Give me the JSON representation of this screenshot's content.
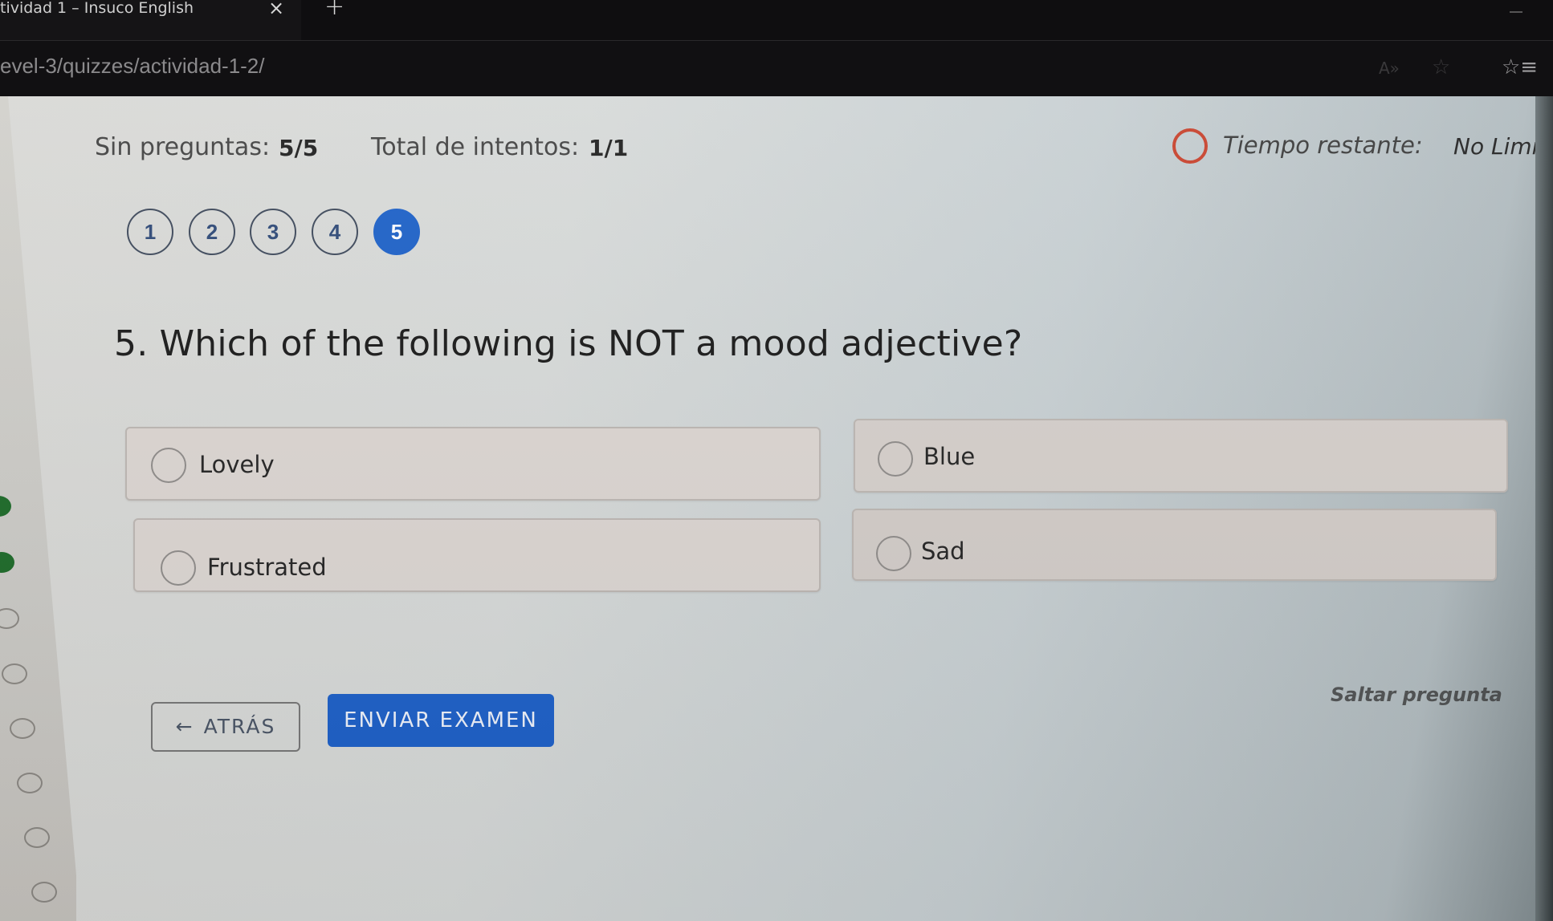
{
  "browser": {
    "tab_title": "tividad 1 – Insuco English",
    "tab_close_icon": "×",
    "new_tab_icon": "+",
    "url": "evel-3/quizzes/actividad-1-2/",
    "icons": {
      "read_aloud": "A»",
      "favorite": "☆",
      "favorites_list": "☆≡"
    }
  },
  "quiz": {
    "questions_label": "Sin preguntas:",
    "questions_value": "5/5",
    "attempts_label": "Total de intentos:",
    "attempts_value": "1/1",
    "timer_label": "Tiempo restante:",
    "timer_value": "No Limit",
    "timer_color": "#c8442f",
    "accent_color": "#1f62c8",
    "nav": [
      {
        "label": "1",
        "active": false
      },
      {
        "label": "2",
        "active": false
      },
      {
        "label": "3",
        "active": false
      },
      {
        "label": "4",
        "active": false
      },
      {
        "label": "5",
        "active": true
      }
    ],
    "question": "5. Which of the following is NOT a mood adjective?",
    "options": [
      {
        "label": "Lovely",
        "selected": false
      },
      {
        "label": "Blue",
        "selected": false
      },
      {
        "label": "Frustrated",
        "selected": false
      },
      {
        "label": "Sad",
        "selected": false
      }
    ],
    "back_arrow": "←",
    "back_label": "ATRÁS",
    "submit_label": "ENVIAR EXAMEN",
    "skip_label": "Saltar pregunta"
  },
  "sidebar": {
    "items": [
      {
        "status": "done"
      },
      {
        "status": "done"
      },
      {
        "status": "pending"
      },
      {
        "status": "pending"
      },
      {
        "status": "pending"
      },
      {
        "status": "pending"
      },
      {
        "status": "pending"
      },
      {
        "status": "pending"
      }
    ]
  }
}
